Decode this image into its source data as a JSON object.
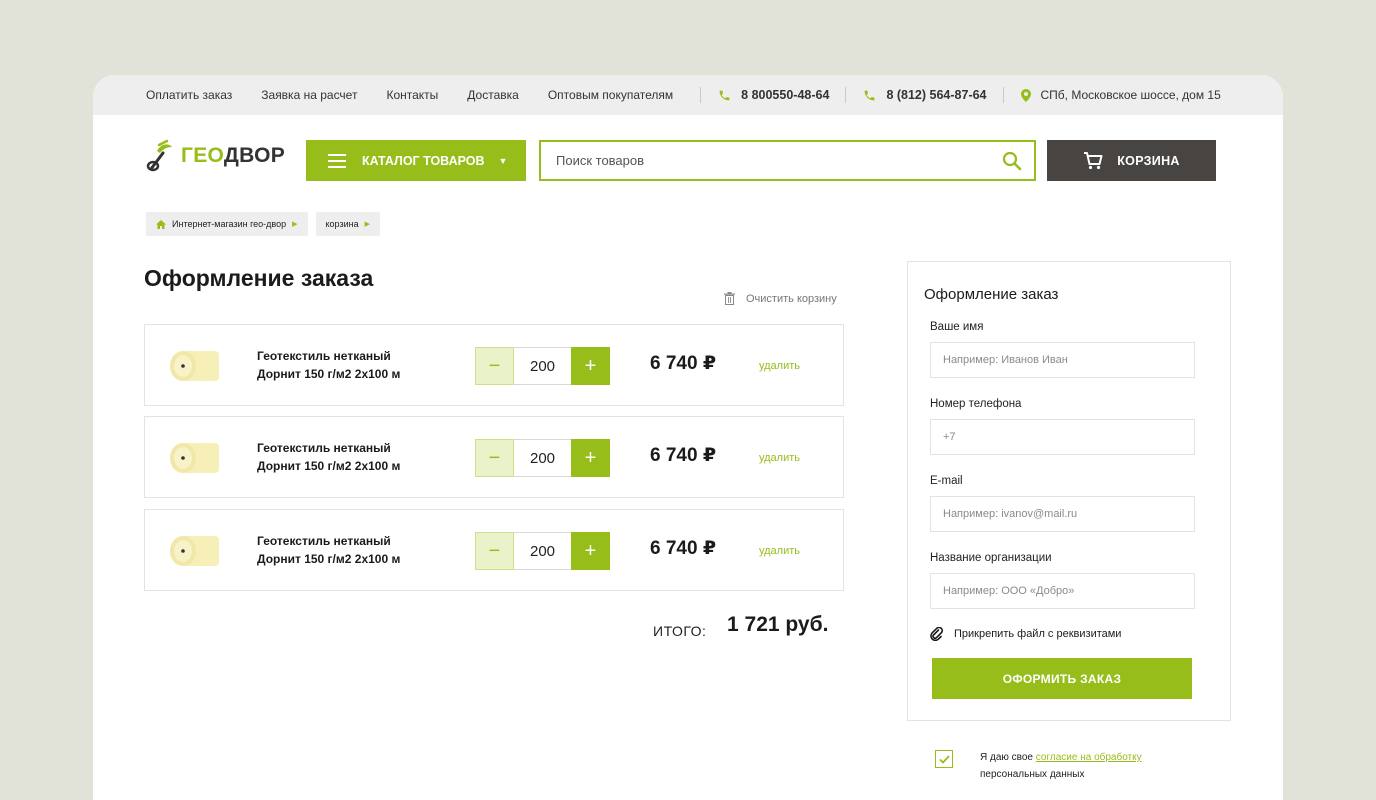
{
  "colors": {
    "accent": "#97bd1b",
    "dark": "#484442",
    "bg": "#e1e3d8"
  },
  "topbar": {
    "links": [
      "Оплатить заказ",
      "Заявка на расчет",
      "Контакты",
      "Доставка",
      "Оптовым покупателям"
    ],
    "phone1": "8 800550-48-64",
    "phone2": "8 (812) 564-87-64",
    "address": "СПб, Московское шоссе, дом 15"
  },
  "header": {
    "logo_part1": "ГЕО",
    "logo_part2": "ДВОР",
    "catalog_label": "КАТАЛОГ ТОВАРОВ",
    "search_placeholder": "Поиск товаров",
    "cart_label": "КОРЗИНА"
  },
  "breadcrumbs": [
    "Интернет-магазин гео-двор",
    "корзина"
  ],
  "page_title": "Оформление заказа",
  "clear_cart": "Очистить корзину",
  "cart": {
    "items": [
      {
        "name_line1": "Геотекстиль нетканый",
        "name_line2": "Дорнит 150 г/м2 2х100 м",
        "qty": "200",
        "price": "6 740 ₽",
        "delete": "удалить"
      },
      {
        "name_line1": "Геотекстиль нетканый",
        "name_line2": "Дорнит 150 г/м2 2х100 м",
        "qty": "200",
        "price": "6 740 ₽",
        "delete": "удалить"
      },
      {
        "name_line1": "Геотекстиль нетканый",
        "name_line2": "Дорнит 150 г/м2 2х100 м",
        "qty": "200",
        "price": "6 740 ₽",
        "delete": "удалить"
      }
    ],
    "minus": "−",
    "plus": "+",
    "total_label": "ИТОГО:",
    "total_value": "1 721 руб."
  },
  "form": {
    "title": "Оформление заказ",
    "name_label": "Ваше имя",
    "name_placeholder": "Например: Иванов Иван",
    "phone_label": "Номер телефона",
    "phone_placeholder": "+7",
    "email_label": "E-mail",
    "email_placeholder": "Например: ivanov@mail.ru",
    "org_label": "Название организации",
    "org_placeholder": "Например: ООО «Добро»",
    "attach_label": "Прикрепить файл с реквизитами",
    "submit_label": "ОФОРМИТЬ ЗАКАЗ"
  },
  "consent": {
    "text_before": "Я даю свое ",
    "link_text": "согласие на обработку",
    "text_after": "персональных данных",
    "checked": true
  }
}
